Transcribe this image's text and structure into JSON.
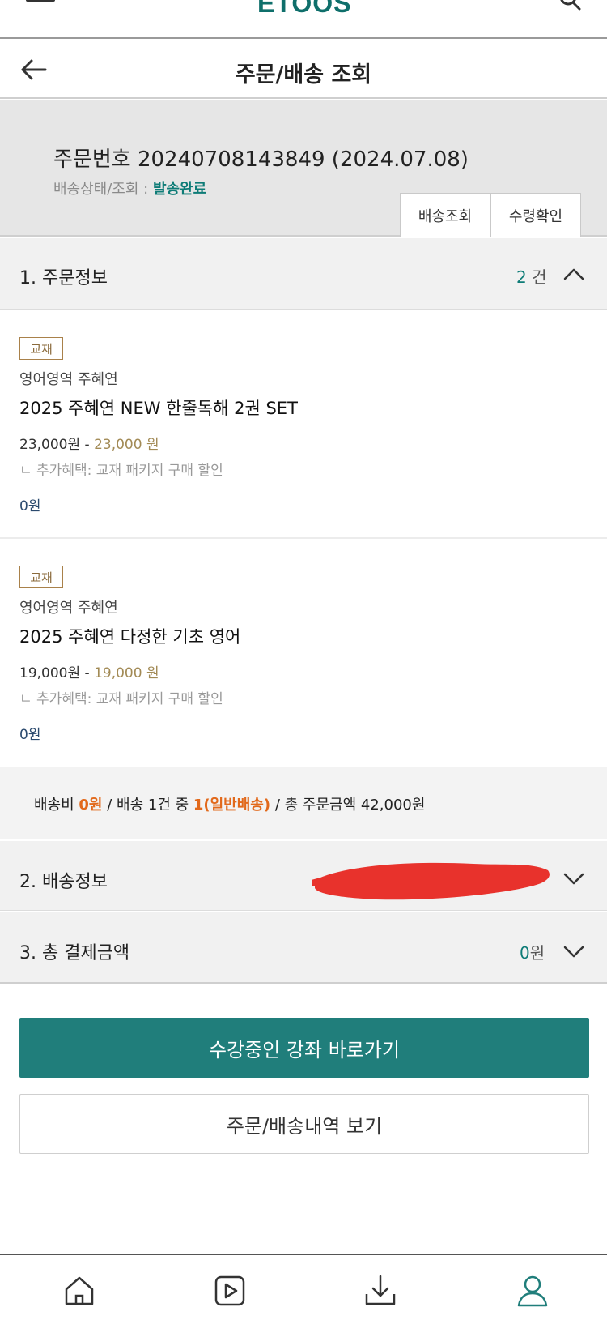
{
  "header": {
    "logo": "ETOOS",
    "icons": [
      "menu-icon",
      "search-icon"
    ]
  },
  "title_bar": {
    "title": "주문/배송 조회",
    "back_icon": "arrow-left-icon"
  },
  "order": {
    "number_label": "주문번호 20240708143849 (2024.07.08)",
    "status_prefix": "배송상태/조회 : ",
    "status_value": "발송완료",
    "buttons": [
      "배송조회",
      "수령확인"
    ]
  },
  "section1": {
    "label": "1. 주문정보",
    "count": "2",
    "count_unit": "건"
  },
  "items": [
    {
      "badge": "교재",
      "category": "영어영역 주혜연",
      "name": "2025 주혜연 NEW 한줄독해 2권 SET",
      "price": "23,000원 - ",
      "sale_price": "23,000 원",
      "benefit": "ㄴ 추가혜택: 교재 패키지 구매 할인",
      "total": "0원"
    },
    {
      "badge": "교재",
      "category": "영어영역 주혜연",
      "name": "2025 주혜연 다정한 기초 영어",
      "price": "19,000원 - ",
      "sale_price": "19,000 원",
      "benefit": "ㄴ 추가혜택: 교재 패키지 구매 할인",
      "total": "0원"
    }
  ],
  "summary": {
    "shipping_label": "배송비 ",
    "shipping_value": "0원",
    "sep1": " / 배송 1건 중 ",
    "delivery_value": "1(일반배송)",
    "sep2": " / 총 주문금액 ",
    "total_value": "42,000원"
  },
  "section2": {
    "label": "2. 배송정보"
  },
  "section3": {
    "label": "3. 총 결제금액",
    "amount": "0",
    "amount_unit": "원"
  },
  "actions": {
    "primary": "수강중인 강좌 바로가기",
    "secondary": "주문/배송내역 보기"
  },
  "bottom_nav": [
    "home-icon",
    "play-icon",
    "download-icon",
    "user-icon"
  ],
  "colors": {
    "brand": "#207e7b",
    "accent_orange": "#e2691b",
    "redaction": "#e8322c"
  }
}
